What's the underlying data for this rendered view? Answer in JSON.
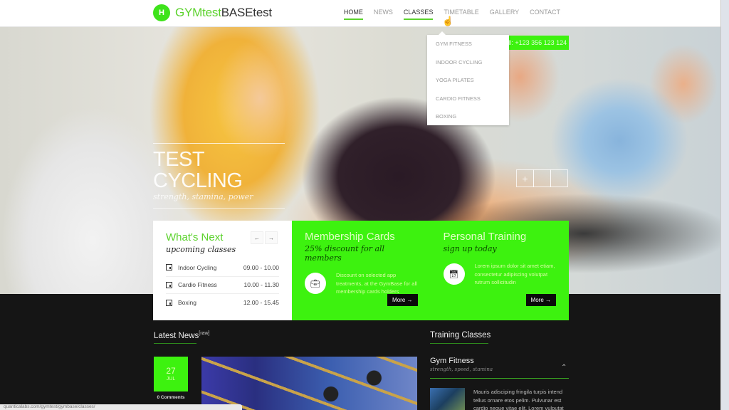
{
  "header": {
    "logo_badge": "H",
    "logo_part1": "GYMtest",
    "logo_part2": "BASEtest",
    "nav": [
      {
        "label": "HOME",
        "active": true
      },
      {
        "label": "NEWS",
        "active": false
      },
      {
        "label": "CLASSES",
        "active": true
      },
      {
        "label": "TIMETABLE",
        "active": false
      },
      {
        "label": "GALLERY",
        "active": false
      },
      {
        "label": "CONTACT",
        "active": false
      }
    ]
  },
  "dropdown": {
    "items": [
      "GYM FITNESS",
      "INDOOR CYCLING",
      "YOGA PILATES",
      "CARDIO FITNESS",
      "BOXING"
    ]
  },
  "hero": {
    "phone": "Call: +123 356 123 124",
    "title": "TEST CYCLING",
    "subtitle": "strength, stamina, power",
    "controls": [
      "+",
      "",
      ""
    ]
  },
  "whats_next": {
    "title": "What's Next",
    "subtitle": "upcoming classes",
    "prev": "←",
    "next": "→",
    "classes": [
      {
        "name": "Indoor Cycling",
        "time": "09.00 - 10.00"
      },
      {
        "name": "Cardio Fitness",
        "time": "10.00 - 11.30"
      },
      {
        "name": "Boxing",
        "time": "12.00 - 15.45"
      }
    ]
  },
  "membership": {
    "title": "Membership Cards",
    "subtitle": "25% discount for all members",
    "icon": "briefcase-icon",
    "text": "Discount on selected app treatments, at the GymBase for all membership cards holders",
    "button": "More →"
  },
  "personal": {
    "title": "Personal Training",
    "subtitle": "sign up today",
    "icon": "calendar-icon",
    "text": "Lorem ipsum dolor sit amet etiam, consectetur adipiscing volutpat rutrum sollicitudin",
    "button": "More →"
  },
  "news": {
    "title": "Latest News",
    "tag": "[raw]",
    "date_day": "27",
    "date_month": "JUL",
    "comments": "0 Comments"
  },
  "training": {
    "title": "Training Classes",
    "class_title": "Gym Fitness",
    "class_sub": "strength, speed, stamina",
    "class_text": "Mauris adisciping fringila turpis intend tellus ornare etos pelim. Pulvunar est cardio neque vitae elit. Lorem vulputat"
  },
  "status_bar": {
    "url": "quanticalabs.com/gymtest/gymbase/classes/"
  },
  "colors": {
    "brand_green": "#3df20f",
    "accent_green": "#5bd22c",
    "dark_bg": "#151515"
  }
}
